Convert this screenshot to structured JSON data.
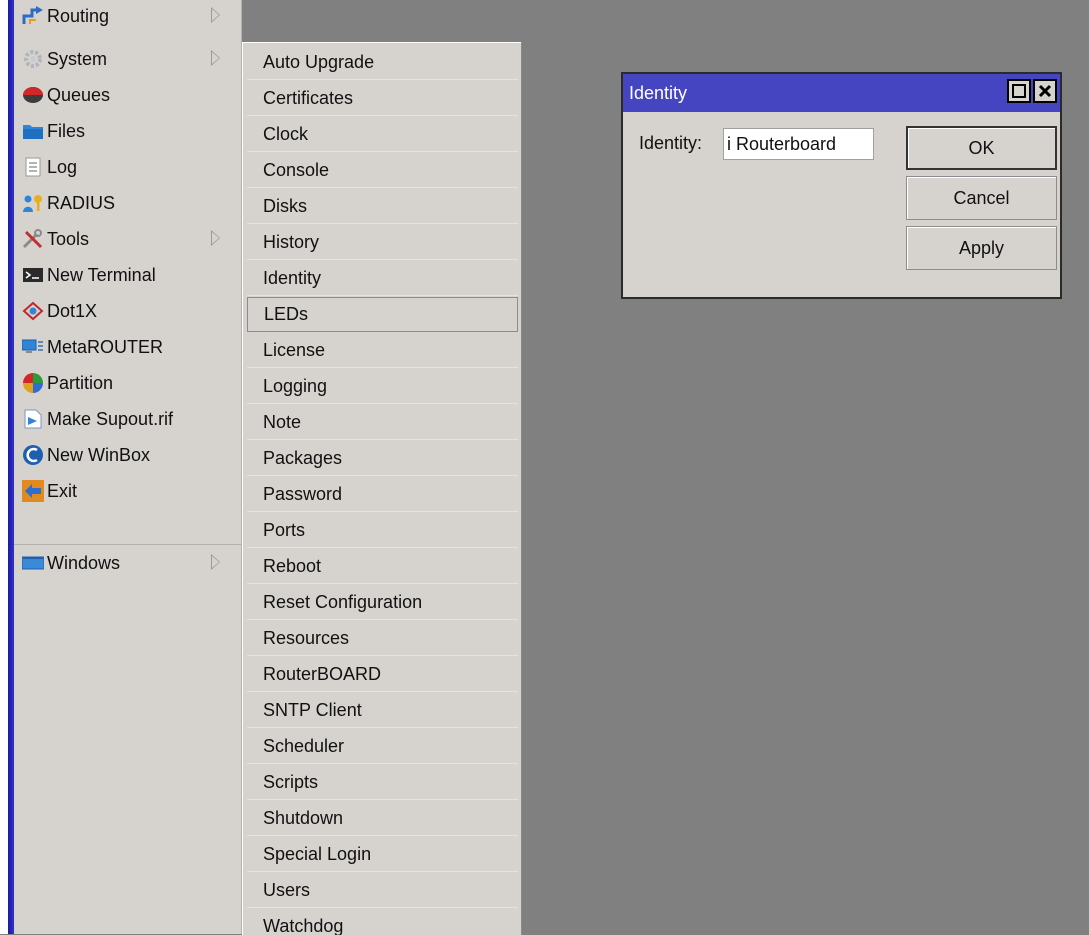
{
  "sidebar": {
    "items": [
      {
        "label": "Routing",
        "icon": "routing-icon",
        "has_submenu": true
      },
      {
        "label": "System",
        "icon": "system-gear-icon",
        "has_submenu": true
      },
      {
        "label": "Queues",
        "icon": "queues-icon",
        "has_submenu": false
      },
      {
        "label": "Files",
        "icon": "folder-icon",
        "has_submenu": false
      },
      {
        "label": "Log",
        "icon": "log-document-icon",
        "has_submenu": false
      },
      {
        "label": "RADIUS",
        "icon": "radius-users-icon",
        "has_submenu": false
      },
      {
        "label": "Tools",
        "icon": "tools-icon",
        "has_submenu": true
      },
      {
        "label": "New Terminal",
        "icon": "terminal-icon",
        "has_submenu": false
      },
      {
        "label": "Dot1X",
        "icon": "dot1x-icon",
        "has_submenu": false
      },
      {
        "label": "MetaROUTER",
        "icon": "metarouter-icon",
        "has_submenu": false
      },
      {
        "label": "Partition",
        "icon": "partition-pie-icon",
        "has_submenu": false
      },
      {
        "label": "Make Supout.rif",
        "icon": "supout-file-icon",
        "has_submenu": false
      },
      {
        "label": "New WinBox",
        "icon": "winbox-icon",
        "has_submenu": false
      },
      {
        "label": "Exit",
        "icon": "exit-icon",
        "has_submenu": false
      }
    ],
    "windows": {
      "label": "Windows",
      "icon": "windows-icon",
      "has_submenu": true
    }
  },
  "submenu": {
    "items": [
      "Auto Upgrade",
      "Certificates",
      "Clock",
      "Console",
      "Disks",
      "History",
      "Identity",
      "LEDs",
      "License",
      "Logging",
      "Note",
      "Packages",
      "Password",
      "Ports",
      "Reboot",
      "Reset Configuration",
      "Resources",
      "RouterBOARD",
      "SNTP Client",
      "Scheduler",
      "Scripts",
      "Shutdown",
      "Special Login",
      "Users",
      "Watchdog"
    ],
    "selected": "LEDs"
  },
  "dialog": {
    "title": "Identity",
    "field_label": "Identity:",
    "field_value": "i Routerboard",
    "ok_label": "OK",
    "cancel_label": "Cancel",
    "apply_label": "Apply"
  },
  "colors": {
    "desktop": "#808080",
    "menu_bg": "#d6d3ce",
    "titlebar": "#4545c2",
    "left_edge": "#2828b4"
  }
}
